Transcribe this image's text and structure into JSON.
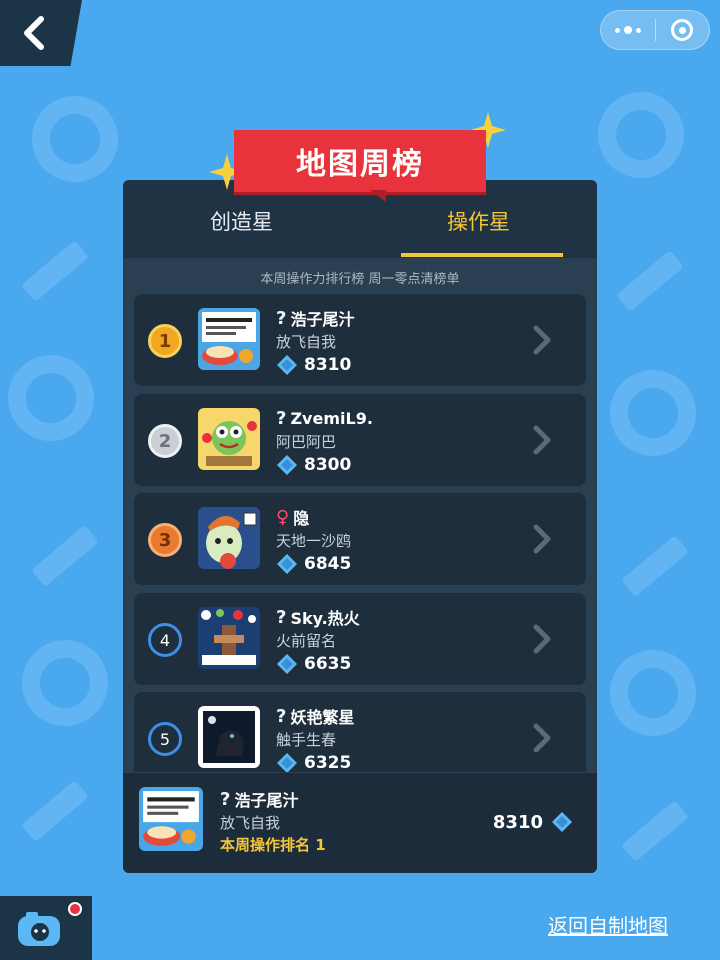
{
  "banner": {
    "title": "地图周榜"
  },
  "tabs": [
    {
      "label": "创造星"
    },
    {
      "label": "操作星"
    }
  ],
  "active_tab": "操作星",
  "subtitle": "本周操作力排行榜 周一零点清榜单",
  "leaderboard": [
    {
      "rank": "1",
      "name": "浩子尾汁",
      "gender_icon": "?",
      "map": "放飞自我",
      "score": "8310"
    },
    {
      "rank": "2",
      "name": "ZvemiL9.",
      "gender_icon": "?",
      "map": "阿巴阿巴",
      "score": "8300"
    },
    {
      "rank": "3",
      "name": "隐",
      "gender_icon": "♀",
      "map": "天地一沙鸥",
      "score": "6845"
    },
    {
      "rank": "4",
      "name": "Sky.热火",
      "gender_icon": "?",
      "map": "火前留名",
      "score": "6635"
    },
    {
      "rank": "5",
      "name": "妖艳繁星",
      "gender_icon": "?",
      "map": "触手生春",
      "score": "6325"
    }
  ],
  "my_entry": {
    "name": "浩子尾汁",
    "gender_icon": "?",
    "map": "放飞自我",
    "rank_text": "本周操作排名 1",
    "score": "8310"
  },
  "return_link": "返回自制地图",
  "icons": {
    "back": "chevron-left-icon",
    "menu": "more-dots-icon",
    "close": "target-icon",
    "gem": "diamond-icon",
    "row_arrow": "chevron-right-icon",
    "helper": "camera-robot-icon"
  },
  "colors": {
    "accent": "#f4c535",
    "banner": "#e8323c",
    "background": "#49a8ee",
    "panel": "#2b3f52"
  }
}
